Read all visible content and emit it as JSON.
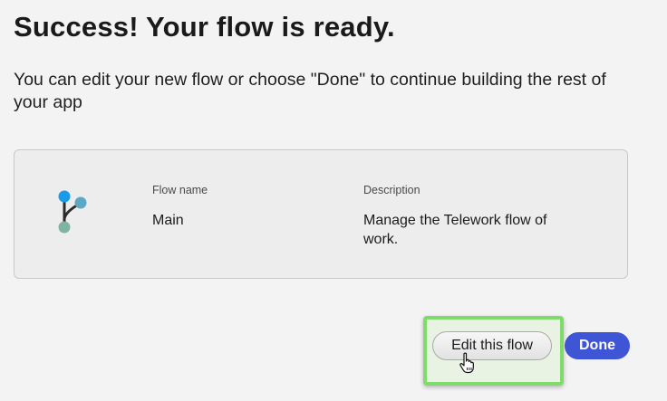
{
  "header": {
    "title": "Success! Your flow is ready.",
    "subtitle": "You can edit your new flow or choose \"Done\" to continue building the rest of your app"
  },
  "flow_card": {
    "icon": "flow-branch-icon",
    "name_label": "Flow name",
    "name_value": "Main",
    "description_label": "Description",
    "description_value": "Manage the Telework flow of work."
  },
  "actions": {
    "edit_label": "Edit this flow",
    "done_label": "Done"
  },
  "colors": {
    "primary_button": "#3e55d6",
    "highlight_border": "#7fdc6b",
    "flow_icon_blue": "#1a9be8",
    "flow_icon_teal": "#5ba8c4",
    "flow_icon_green": "#7fb3a3"
  }
}
